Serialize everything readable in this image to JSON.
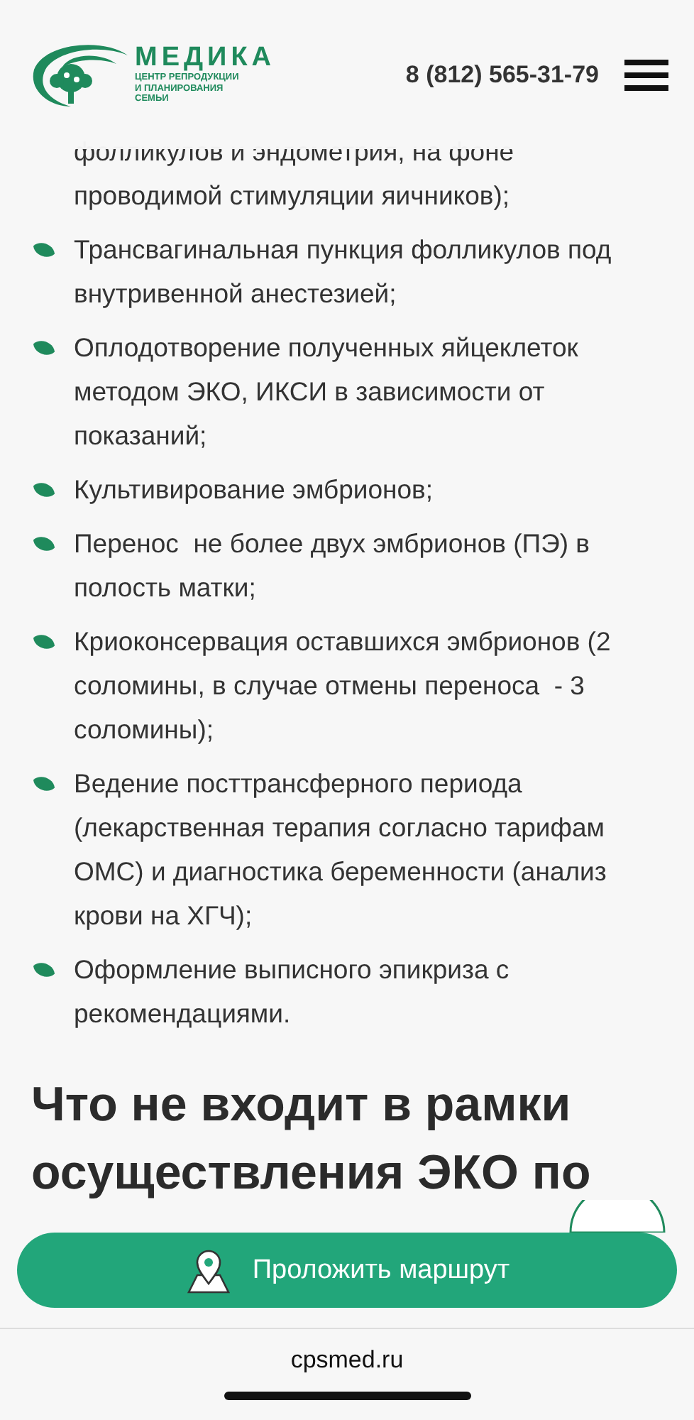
{
  "header": {
    "logo": {
      "name": "МЕДИКА",
      "tagline": [
        "ЦЕНТР РЕПРОДУКЦИИ",
        "И ПЛАНИРОВАНИЯ",
        "СЕМЬИ"
      ]
    },
    "phone": "8 (812) 565-31-79"
  },
  "list": [
    {
      "lines": [
        "фолликулов и эндометрия, на фоне",
        "проводимой стимуляции яичников);"
      ],
      "bullet": false
    },
    {
      "lines": [
        "Трансвагинальная пункция фолликулов под",
        "внутривенной анестезией;"
      ],
      "bullet": true
    },
    {
      "lines": [
        "Оплодотворение полученных яйцеклеток",
        "методом ЭКО, ИКСИ в зависимости от",
        "показаний;"
      ],
      "bullet": true
    },
    {
      "lines": [
        "Культивирование эмбрионов;"
      ],
      "bullet": true
    },
    {
      "lines": [
        "Перенос  не более двух эмбрионов (ПЭ) в",
        "полость матки;"
      ],
      "bullet": true
    },
    {
      "lines": [
        "Криоконсервация оставшихся эмбрионов (2",
        "соломины, в случае отмены переноса  - 3",
        "соломины);"
      ],
      "bullet": true
    },
    {
      "lines": [
        "Ведение посттрансферного периода",
        "(лекарственная терапия согласно тарифам",
        "ОМС) и диагностика беременности (анализ",
        "крови на ХГЧ);"
      ],
      "bullet": true
    },
    {
      "lines": [
        "Оформление выписного эпикриза с",
        "рекомендациями."
      ],
      "bullet": true
    }
  ],
  "heading": [
    "Что не входит в рамки",
    "осуществления ЭКО по"
  ],
  "route_button": "Проложить маршрут",
  "browser": {
    "url": "cpsmed.ru"
  }
}
